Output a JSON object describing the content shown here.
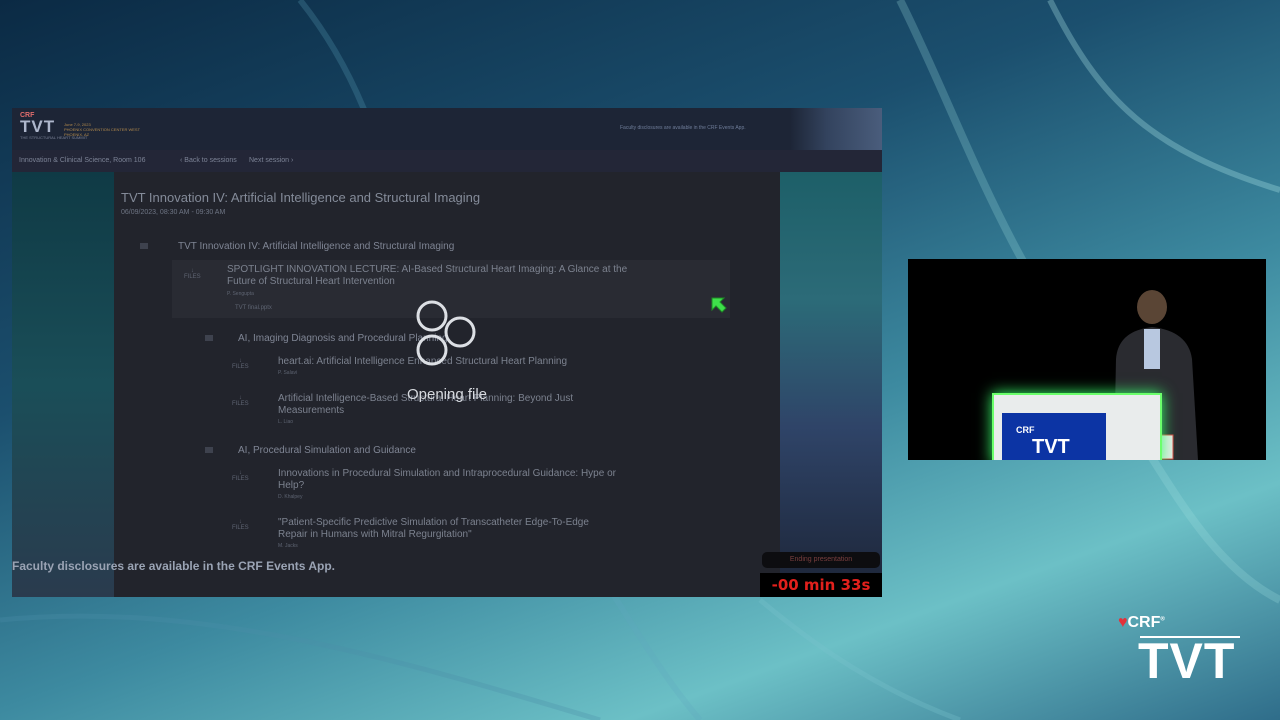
{
  "header": {
    "logo_crf": "CRF",
    "logo_tvt": "TVT",
    "logo_sub": "THE STRUCTURAL HEART SUMMIT",
    "logo_dates": "June 7-9, 2023",
    "logo_venue": "PHOENIX CONVENTION CENTER WEST",
    "logo_city": "PHOENIX, AZ",
    "disclosure": "Faculty disclosures are available in the CRF Events App."
  },
  "nav": {
    "room": "Innovation & Clinical Science, Room 106",
    "back": "Back to sessions",
    "next": "Next session"
  },
  "session": {
    "title": "TVT Innovation IV: Artificial Intelligence and Structural Imaging",
    "date": "06/09/2023, 08:30 AM - 09:30 AM",
    "group_title": "TVT Innovation IV: Artificial Intelligence and Structural Imaging",
    "spotlight": {
      "title_line1": "SPOTLIGHT INNOVATION LECTURE: AI-Based Structural Heart Imaging: A Glance at the",
      "title_line2": "Future of Structural Heart Intervention",
      "author": "P. Sengupta",
      "file_name": "TVT final.pptx"
    },
    "section1": "AI, Imaging Diagnosis and Procedural Planning",
    "item1": {
      "title": "heart.ai: Artificial Intelligence Enhanced Structural Heart Planning",
      "author": "P. Salavi"
    },
    "item2": {
      "title_line1": "Artificial Intelligence-Based Structural Heart Planning: Beyond Just",
      "title_line2": "Measurements",
      "author": "L. Liao"
    },
    "section2": "AI, Procedural Simulation and Guidance",
    "item3": {
      "title_line1": "Innovations in Procedural Simulation and Intraprocedural Guidance: Hype or",
      "title_line2": "Help?",
      "author": "D. Khalpey"
    },
    "item4": {
      "title_line1": "\"Patient-Specific Predictive Simulation of Transcatheter Edge-To-Edge",
      "title_line2": "Repair in Humans with Mitral Regurgitation\"",
      "author": "M. Jacks"
    },
    "files_label": "FILES"
  },
  "footer": {
    "disclosure": "Faculty disclosures are available in the CRF Events App.",
    "ending": "Ending presentation",
    "timer": "-00 min 33s"
  },
  "overlay": {
    "status": "Opening file"
  },
  "video": {
    "podium_crf": "CRF",
    "podium_tvt": "TVT"
  },
  "corner_logo": {
    "crf": "CRF",
    "tvt": "TVT"
  }
}
